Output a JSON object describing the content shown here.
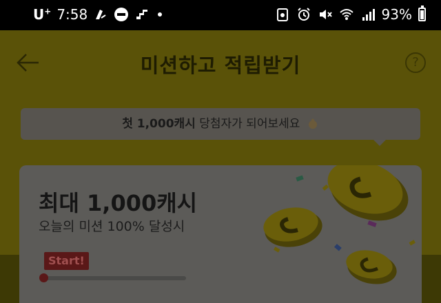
{
  "status_bar": {
    "carrier": "U",
    "carrier_sup": "+",
    "time": "7:58",
    "battery_percent": "93%"
  },
  "header": {
    "title": "미션하고 적립받기",
    "help_symbol": "?"
  },
  "banner": {
    "highlight": "첫 1,000캐시",
    "rest": " 당첨자가 되어보세요"
  },
  "mission_card": {
    "title": "최대 1,000캐시",
    "subtitle": "오늘의 미션 100% 달성시",
    "start_label": "Start!",
    "progress_percent": 0
  },
  "colors": {
    "background_dim": "#5a5208",
    "card": "#5c5b58",
    "accent_red": "#5a1818"
  }
}
